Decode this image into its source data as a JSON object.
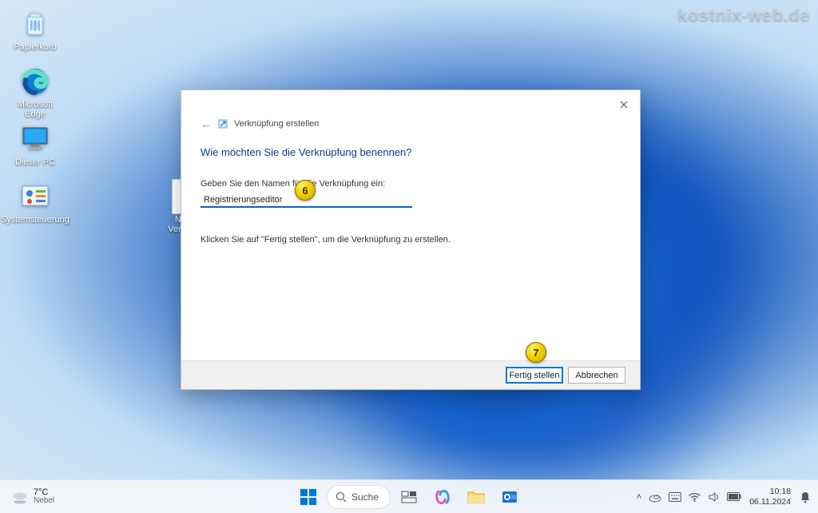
{
  "watermark": "kostnix-web.de",
  "desktop_icons": {
    "recycle_bin": "Papierkorb",
    "edge": "Microsoft Edge",
    "this_pc": "Dieser PC",
    "control_panel": "Systemsteuerung",
    "new_shortcut": "Neue Verknü..."
  },
  "dialog": {
    "breadcrumb": "Verknüpfung erstellen",
    "title": "Wie möchten Sie die Verknüpfung benennen?",
    "field_label": "Geben Sie den Namen für die Verknüpfung ein:",
    "name_value": "Registrierungseditor",
    "hint": "Klicken Sie auf \"Fertig stellen\", um die Verknüpfung zu erstellen.",
    "finish": "Fertig stellen",
    "cancel": "Abbrechen"
  },
  "annotations": {
    "b6": "6",
    "b7": "7"
  },
  "taskbar": {
    "weather_temp": "7°C",
    "weather_cond": "Nebel",
    "search": "Suche",
    "time": "10:18",
    "date": "06.11.2024"
  }
}
